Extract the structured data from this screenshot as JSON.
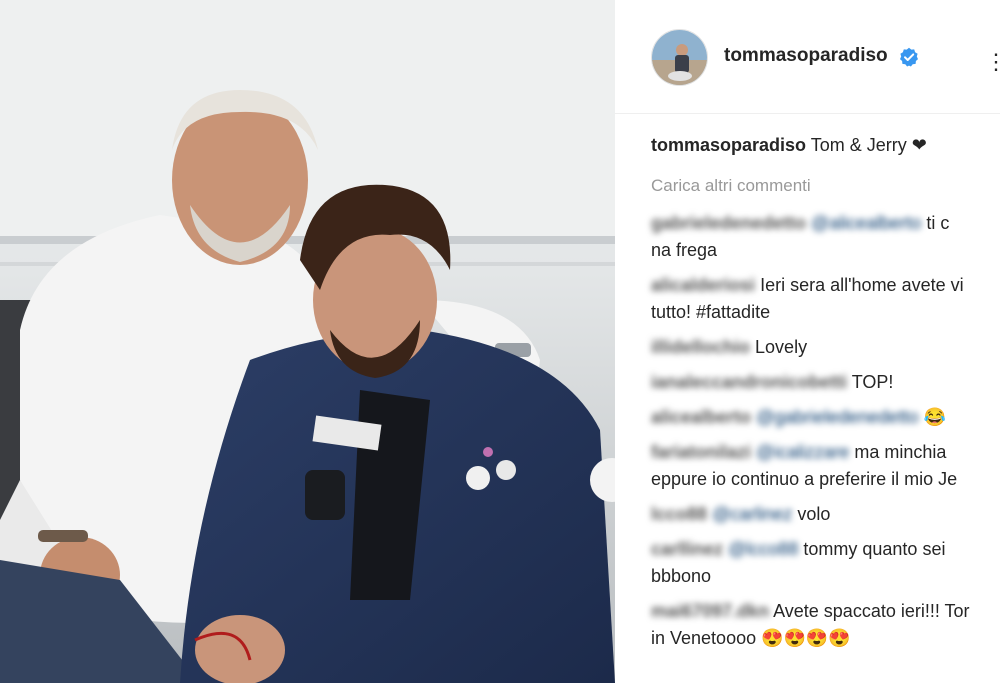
{
  "post": {
    "username": "tommasoparadiso",
    "verified_icon": "verified-badge-icon",
    "more_icon": "more-options-icon"
  },
  "caption": {
    "username": "tommasoparadiso",
    "text": "Tom & Jerry",
    "emoji": "❤"
  },
  "load_more_label": "Carica altri commenti",
  "comments": [
    {
      "user": "gabrieledenedetto",
      "mention": "@alicealberto",
      "line1": "ti c",
      "line2": "na frega"
    },
    {
      "user": "alicalderiosi",
      "mention": "",
      "line1": "Ieri sera all'home avete vi",
      "line2": "tutto! #fattadite"
    },
    {
      "user": "illidellochio",
      "mention": "",
      "line1": "Lovely",
      "line2": ""
    },
    {
      "user": "ianaleccandronicobetti",
      "mention": "",
      "line1": "TOP!",
      "line2": ""
    },
    {
      "user": "alicealberto",
      "mention": "@gabrieledenedetto",
      "line1": "😂",
      "line2": ""
    },
    {
      "user": "fariatonilazi",
      "mention": "@icalizzare",
      "line1": "ma minchia",
      "line2": "eppure io continuo a preferire il mio Je"
    },
    {
      "user": "lcco88",
      "mention": "@carlinez",
      "line1": "volo",
      "line2": ""
    },
    {
      "user": "carllinez",
      "mention": "@lcco88",
      "line1": "tommy quanto sei",
      "line2": "bbbono"
    },
    {
      "user": "mai67097.dkn",
      "mention": "",
      "line1": "Avete spaccato ieri!!! Tor",
      "line2": "in Venetoooo 😍😍😍😍"
    }
  ],
  "colors": {
    "text": "#262626",
    "muted": "#999999",
    "verified_blue": "#3897f0",
    "mention_blue": "#003569"
  }
}
